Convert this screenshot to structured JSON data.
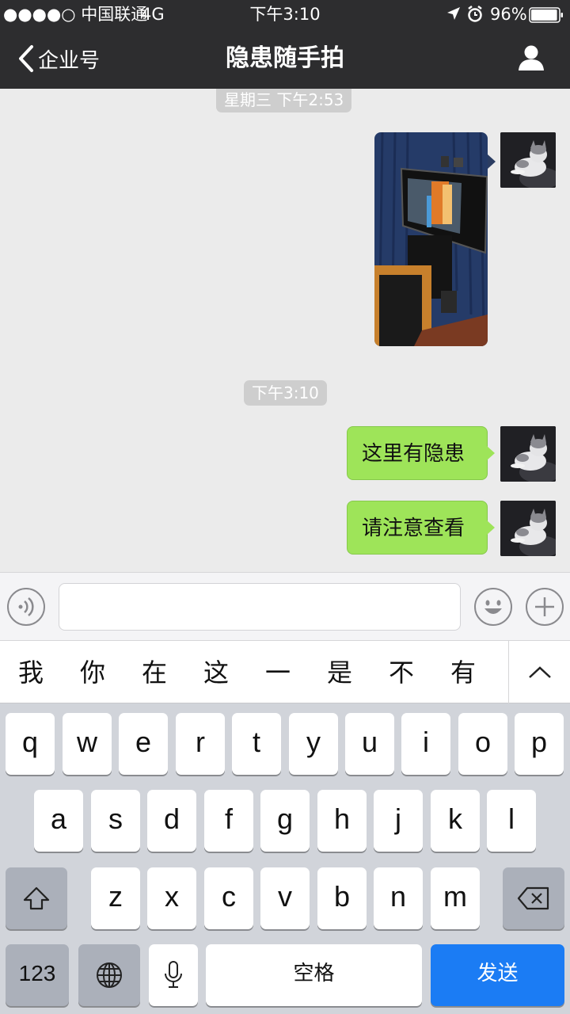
{
  "status_bar": {
    "carrier": "●●●●○ 中国联通",
    "network": "4G",
    "time": "下午3:10",
    "battery_pct": "96%",
    "battery_level": 0.96
  },
  "nav": {
    "back_label": "企业号",
    "title": "隐患随手拍"
  },
  "chat": {
    "messages": [
      {
        "type": "timestamp",
        "text": "星期三 下午2:53"
      },
      {
        "type": "image",
        "sender": "self",
        "content": "photo of TV screen on stand"
      },
      {
        "type": "timestamp",
        "text": "下午3:10"
      },
      {
        "type": "text",
        "sender": "self",
        "text": "这里有隐患"
      },
      {
        "type": "text",
        "sender": "self",
        "text": "请注意查看"
      }
    ]
  },
  "input": {
    "value": "",
    "voice_icon": "voice-icon",
    "emoji_icon": "emoji-icon",
    "plus_icon": "plus-icon"
  },
  "candidates": [
    "我",
    "你",
    "在",
    "这",
    "一",
    "是",
    "不",
    "有"
  ],
  "keyboard": {
    "row1": [
      "q",
      "w",
      "e",
      "r",
      "t",
      "y",
      "u",
      "i",
      "o",
      "p"
    ],
    "row2": [
      "a",
      "s",
      "d",
      "f",
      "g",
      "h",
      "j",
      "k",
      "l"
    ],
    "row3": [
      "z",
      "x",
      "c",
      "v",
      "b",
      "n",
      "m"
    ],
    "numbers_label": "123",
    "space_label": "空格",
    "send_label": "发送"
  },
  "colors": {
    "header_bg": "#2d2d2f",
    "chat_bg": "#ebebeb",
    "bubble_green": "#9ee459",
    "send_blue": "#1b7cf4"
  }
}
